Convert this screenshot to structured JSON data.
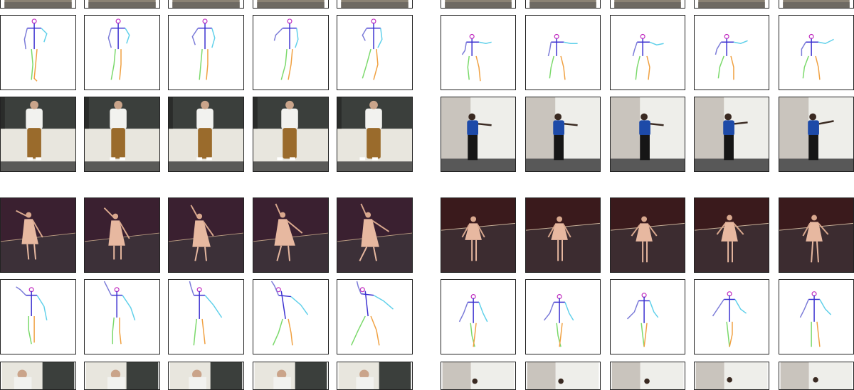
{
  "figure": {
    "description_visible_text": "",
    "groups": [
      {
        "id": "top-left",
        "rows": [
          "photo-strip-partial",
          "skeleton",
          "photo-man-white-shirt"
        ],
        "frames": 5
      },
      {
        "id": "top-right",
        "rows": [
          "photo-strip-partial",
          "skeleton",
          "photo-woman-blue-shirt"
        ],
        "frames": 5
      },
      {
        "id": "bottom-left",
        "rows": [
          "photo-ballerina",
          "skeleton",
          "photo-strip-partial"
        ],
        "frames": 5
      },
      {
        "id": "bottom-right",
        "rows": [
          "photo-ballerina",
          "skeleton",
          "photo-strip-partial"
        ],
        "frames": 5
      }
    ]
  },
  "colors": {
    "tile_border": "#222222",
    "skeleton_spine": "#3a2fd0",
    "skeleton_head": "#c02abf",
    "skeleton_arm_right": "#5fd0ea",
    "skeleton_arm_left": "#7a7ad8",
    "skeleton_leg_right": "#f0a040",
    "skeleton_leg_left": "#7ad96a",
    "office_wall": "#e8e6de",
    "office_panel": "#3b3f3c",
    "stage_backdrop": "#3a2030",
    "stage_floor": "#3c3038",
    "dress": "#e7b8a0"
  }
}
